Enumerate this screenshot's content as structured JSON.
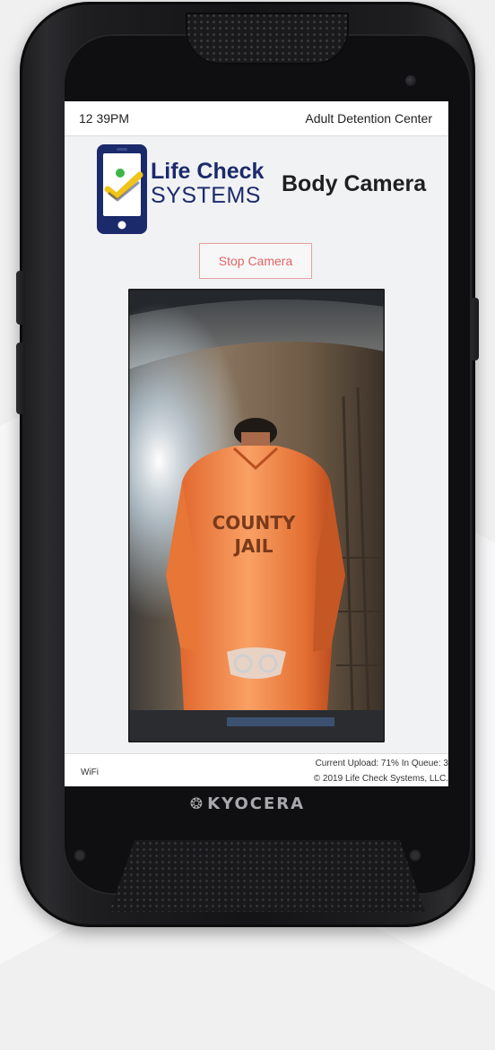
{
  "status_bar": {
    "time": "12 39PM",
    "location": "Adult Detention Center"
  },
  "logo": {
    "line1": "Life Check",
    "line2": "SYSTEMS"
  },
  "header": {
    "title": "Body Camera"
  },
  "controls": {
    "stop_camera_label": "Stop Camera"
  },
  "camera_feed": {
    "uniform_text_line1": "COUNTY",
    "uniform_text_line2": "JAIL"
  },
  "footer": {
    "connection": "WiFi",
    "upload_status": "Current Upload: 71% In Queue: 3",
    "copyright": "© 2019 Life Check Systems, LLC."
  },
  "device": {
    "brand": "KYOCERA"
  },
  "colors": {
    "logo_navy": "#1b2a6b",
    "logo_green": "#3fb54a",
    "logo_yellow": "#f0c419",
    "stop_button": "#e06565"
  }
}
